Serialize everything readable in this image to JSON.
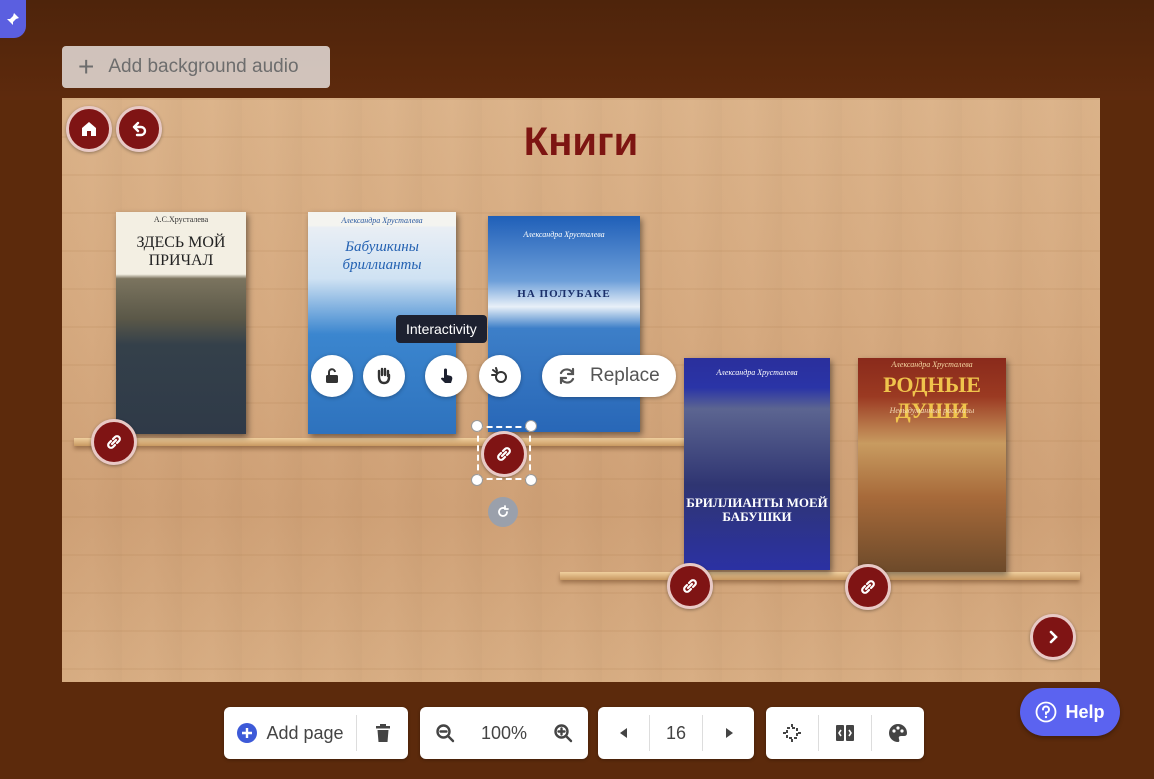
{
  "header": {
    "add_audio_label": "Add background audio"
  },
  "page": {
    "title": "Книги"
  },
  "books": [
    {
      "author": "А.С.Хрусталева",
      "title": "ЗДЕСЬ МОЙ ПРИЧАЛ"
    },
    {
      "author": "Александра Хрусталева",
      "title": "Бабушкины бриллианты"
    },
    {
      "author": "Александра Хрусталева",
      "title": "НА ПОЛУБАКЕ"
    },
    {
      "author": "Александра Хрусталева",
      "title": "БРИЛЛИАНТЫ МОЕЙ БАБУШКИ"
    },
    {
      "author": "Александра Хрусталева",
      "title": "РОДНЫЕ ДУШИ",
      "subtitle": "Невыдуманные рассказы"
    }
  ],
  "element_toolbar": {
    "tooltip": "Interactivity",
    "replace_label": "Replace"
  },
  "bottom_toolbar": {
    "add_page_label": "Add page",
    "zoom_level": "100%",
    "page_number": "16"
  },
  "help": {
    "label": "Help"
  },
  "colors": {
    "background": "#5c2a0c",
    "accent_dark_red": "#7f1414",
    "title_color": "#7d1512",
    "help_blue": "#5b63f0"
  }
}
